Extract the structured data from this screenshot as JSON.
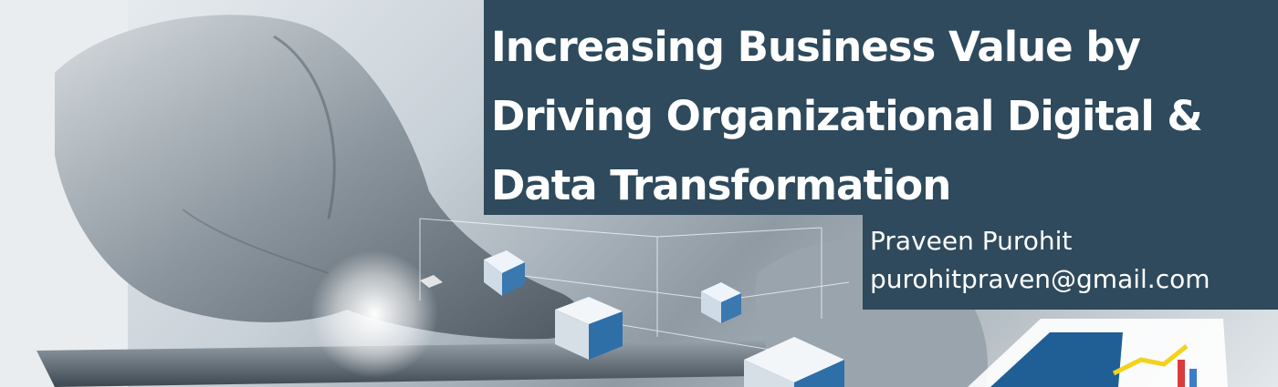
{
  "banner": {
    "title": "Increasing Business Value by\nDriving Organizational Digital &\nData Transformation",
    "author_name": "Praveen Purohit",
    "author_email": "purohitpraven@gmail.com"
  },
  "colors": {
    "panel_background": "#2e4a5c",
    "panel_text": "#ffffff"
  }
}
